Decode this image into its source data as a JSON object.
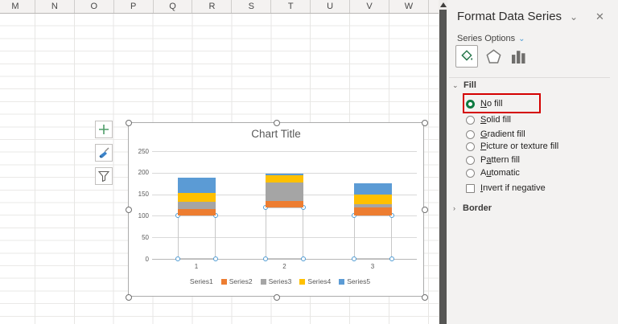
{
  "spreadsheet": {
    "column_headers": [
      "M",
      "N",
      "O",
      "P",
      "Q",
      "R",
      "S",
      "T",
      "U",
      "V",
      "W"
    ]
  },
  "chart_data": {
    "type": "bar",
    "stacked": true,
    "title": "Chart Title",
    "categories": [
      "1",
      "2",
      "3"
    ],
    "series": [
      {
        "name": "Series1",
        "color": "none",
        "values": [
          100,
          120,
          100
        ],
        "selected": true,
        "note": "fill set to No fill, only outline and selection handles visible"
      },
      {
        "name": "Series2",
        "color": "#ED7D31",
        "values": [
          15,
          15,
          20
        ]
      },
      {
        "name": "Series3",
        "color": "#A5A5A5",
        "values": [
          18,
          42,
          7
        ]
      },
      {
        "name": "Series4",
        "color": "#FFC000",
        "values": [
          20,
          17,
          23
        ]
      },
      {
        "name": "Series5",
        "color": "#5B9BD5",
        "values": [
          35,
          4,
          25
        ]
      }
    ],
    "ylim": [
      0,
      250
    ],
    "yticks": [
      0,
      50,
      100,
      150,
      200,
      250
    ],
    "legend_position": "bottom",
    "grid": true
  },
  "pane": {
    "title": "Format Data Series",
    "series_options_label": "Series Options",
    "fill": {
      "heading": "Fill",
      "options": [
        {
          "pre": "",
          "u": "N",
          "post": "o fill",
          "selected": true,
          "highlighted": true
        },
        {
          "pre": "",
          "u": "S",
          "post": "olid fill",
          "selected": false
        },
        {
          "pre": "",
          "u": "G",
          "post": "radient fill",
          "selected": false
        },
        {
          "pre": "",
          "u": "P",
          "post": "icture or texture fill",
          "selected": false
        },
        {
          "pre": "P",
          "u": "a",
          "post": "ttern fill",
          "selected": false
        },
        {
          "pre": "A",
          "u": "u",
          "post": "tomatic",
          "selected": false
        }
      ],
      "checkbox": {
        "pre": "",
        "u": "I",
        "post": "nvert if negative",
        "checked": false
      }
    },
    "border_heading": "Border",
    "colors": {
      "accent_green": "#107C41",
      "highlight_red": "#D40000"
    }
  }
}
